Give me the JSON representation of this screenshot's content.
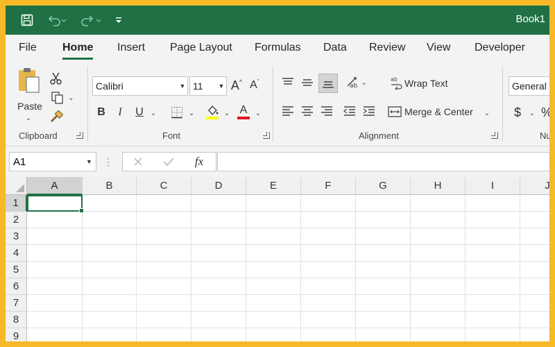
{
  "window": {
    "title": "Book1"
  },
  "quick_access": {
    "save_icon": "save-icon",
    "undo_icon": "undo-icon",
    "redo_icon": "redo-icon",
    "customize_icon": "customize-qat-icon"
  },
  "tabs": [
    {
      "label": "File"
    },
    {
      "label": "Home",
      "active": true
    },
    {
      "label": "Insert"
    },
    {
      "label": "Page Layout"
    },
    {
      "label": "Formulas"
    },
    {
      "label": "Data"
    },
    {
      "label": "Review"
    },
    {
      "label": "View"
    },
    {
      "label": "Developer"
    }
  ],
  "ribbon": {
    "clipboard": {
      "label": "Clipboard",
      "paste_label": "Paste"
    },
    "font": {
      "label": "Font",
      "font_name": "Calibri",
      "font_size": "11",
      "bold": "B",
      "italic": "I",
      "underline": "U",
      "font_color_letter": "A",
      "highlight_color": "#ffff00",
      "font_color": "#e81123"
    },
    "alignment": {
      "label": "Alignment",
      "wrap_text": "Wrap Text",
      "merge_center": "Merge & Center"
    },
    "number": {
      "label": "Nu",
      "format": "General",
      "currency": "$",
      "percent": "%"
    }
  },
  "formula_bar": {
    "name_box": "A1",
    "fx": "fx",
    "formula": ""
  },
  "grid": {
    "columns": [
      "A",
      "B",
      "C",
      "D",
      "E",
      "F",
      "G",
      "H",
      "I",
      "J"
    ],
    "rows": [
      "1",
      "2",
      "3",
      "4",
      "5",
      "6",
      "7",
      "8",
      "9"
    ],
    "active_cell": "A1"
  },
  "colors": {
    "accent": "#1f7145",
    "frame": "#f7b928"
  }
}
